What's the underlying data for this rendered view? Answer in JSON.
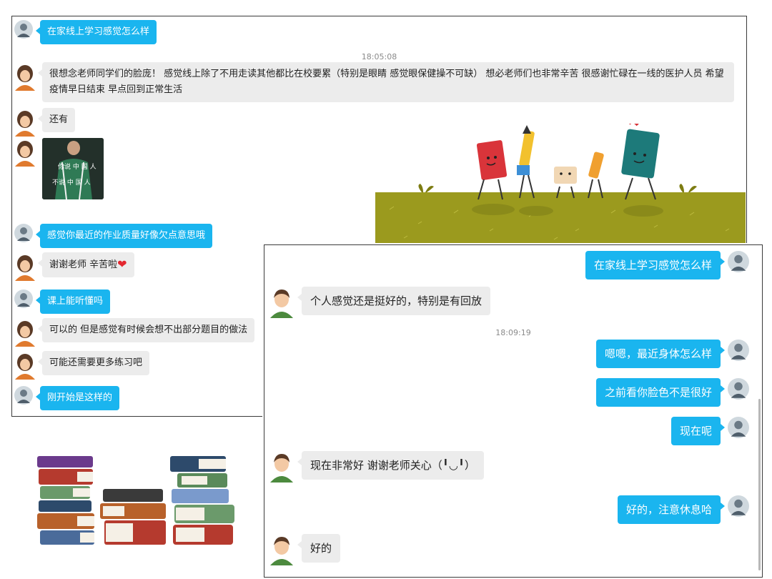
{
  "panel1": {
    "messages": [
      {
        "text": "在家线上学习感觉怎么样"
      },
      {
        "text": "很想念老师同学们的脸庞！ 感觉线上除了不用走读其他都比在校要累（特别是眼睛 感觉眼保健操不可缺） 想必老师们也非常辛苦 很感谢忙碌在一线的医护人员 希望疫情早日结束 早点回到正常生活"
      },
      {
        "text": "还有"
      },
      {
        "text": "感觉你最近的作业质量好像欠点意思哦"
      },
      {
        "text": "谢谢老师 辛苦啦"
      },
      {
        "text": "课上能听懂吗"
      },
      {
        "text": "可以的 但是感觉有时候会想不出部分题目的做法"
      },
      {
        "text": "可能还需要更多练习吧"
      },
      {
        "text": "刚开始是这样的"
      }
    ],
    "timestamp": "18:05:08",
    "image_lines": [
      "你说 中 国 人",
      "不说 中 国 人"
    ]
  },
  "panel2": {
    "messages": [
      {
        "text": "在家线上学习感觉怎么样"
      },
      {
        "text": "个人感觉还是挺好的，特别是有回放"
      },
      {
        "text": "嗯嗯，最近身体怎么样"
      },
      {
        "text": "之前看你脸色不是很好"
      },
      {
        "text": "现在呢"
      },
      {
        "text": "现在非常好 谢谢老师关心（╹◡╹）"
      },
      {
        "text": "好的，注意休息哈"
      },
      {
        "text": "好的"
      }
    ],
    "timestamp": "18:09:19"
  },
  "colors": {
    "bubble_blue": "#1ab5ef",
    "bubble_gray": "#ececec",
    "grass": "#9b9a1e"
  },
  "icons": [
    "teacher-avatar",
    "girl-avatar",
    "boy-avatar",
    "heart-emoji",
    "walking-stationery-illustration",
    "book-stack-illustration"
  ]
}
